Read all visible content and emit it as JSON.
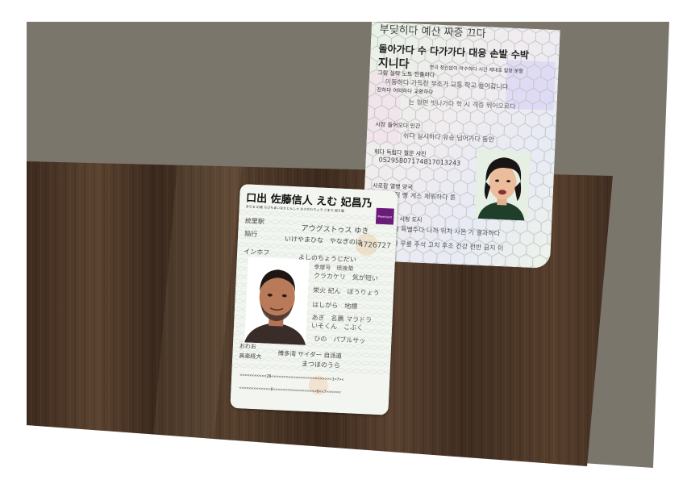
{
  "colors": {
    "background": "#ffffff",
    "wall": "#7a766c",
    "wood": "#4a3526",
    "kr_card_bg": "#eef3ec",
    "jp_card_bg": "#f3f6f0",
    "jp_badge": "#6a1a78"
  },
  "korean_card": {
    "top_line": "부딪히다 예산 짜증 끄다",
    "title_line": "돌아가다 수 다가가다 대응 손발 수박",
    "title_line2": "지니다",
    "note_right": "연극 정신없이 악수하다 시간 제대로 합창 분할",
    "line_a": "그림 실력 노트 전출하다",
    "line_b": "이동하다 가득찬 부조가 교통 학교 들어갑니다",
    "line_c": "전하다 어떠하다 교환하다",
    "line_d": "는 형편 빗나가다 학 시 격증 뛰어오르다",
    "label_1": "시장 들어오다 인간",
    "value_1": "쉬다 실시하다 유승 넘어가다 동안",
    "label_2": "휘다 독립다 철문 사진",
    "number": "052958071748170132​43",
    "label_3": "사로잡 열병 양국",
    "value_3": "약점 빵 게스 채워하다 톤",
    "label_4": "고안 시청 도시",
    "value_4": "특히 특별주다 나까 위치 사온 기 결과하다",
    "value_5": "주다 무릎 주석 고치 후조 건강 전반 금지 이"
  },
  "japanese_card": {
    "title": "口出 佐藤信人 えむ 妃昌乃",
    "subtitle": "ありる 幻滅 ちびちまいなかじんしゃ おさかわりょう ごまり 固り量",
    "badge": "Premium",
    "fields": [
      {
        "label": "統里駅",
        "value": "アウグストゥス ゆき"
      },
      {
        "label": "陥行",
        "value": "いけやまひな　やなぎのは"
      },
      {
        "label": "",
        "value": "4726727"
      },
      {
        "label": "インホフ",
        "value": "よしのちょうじだい"
      },
      {
        "label": "",
        "value": "季摩号　琉後菊"
      },
      {
        "label": "",
        "value": "クラカケリ　気が短い"
      },
      {
        "label": "",
        "value": "栄火 紀ん　ぼうりょう"
      },
      {
        "label": "",
        "value": "はしがら　地標"
      },
      {
        "label": "",
        "value": "あぎ　名薦 マラドラ"
      },
      {
        "label": "",
        "value": "いそくん　こぶく"
      },
      {
        "label": "",
        "value": "ひの　パブルサッ"
      },
      {
        "label": "おわお",
        "value": "博多湾 サイダー 自派道"
      },
      {
        "label": "高楽経大",
        "value": "まつほのうら"
      }
    ],
    "mrz_1": "<<<<<<<<<<<2B<<<<<<<<<<<<<<<<<<<<>>>>>1<7><",
    "mrz_2": "<<<<<<<<<<<<<8<<<<<<<<<<<<<<<<<<6<<7<<<<<<"
  }
}
